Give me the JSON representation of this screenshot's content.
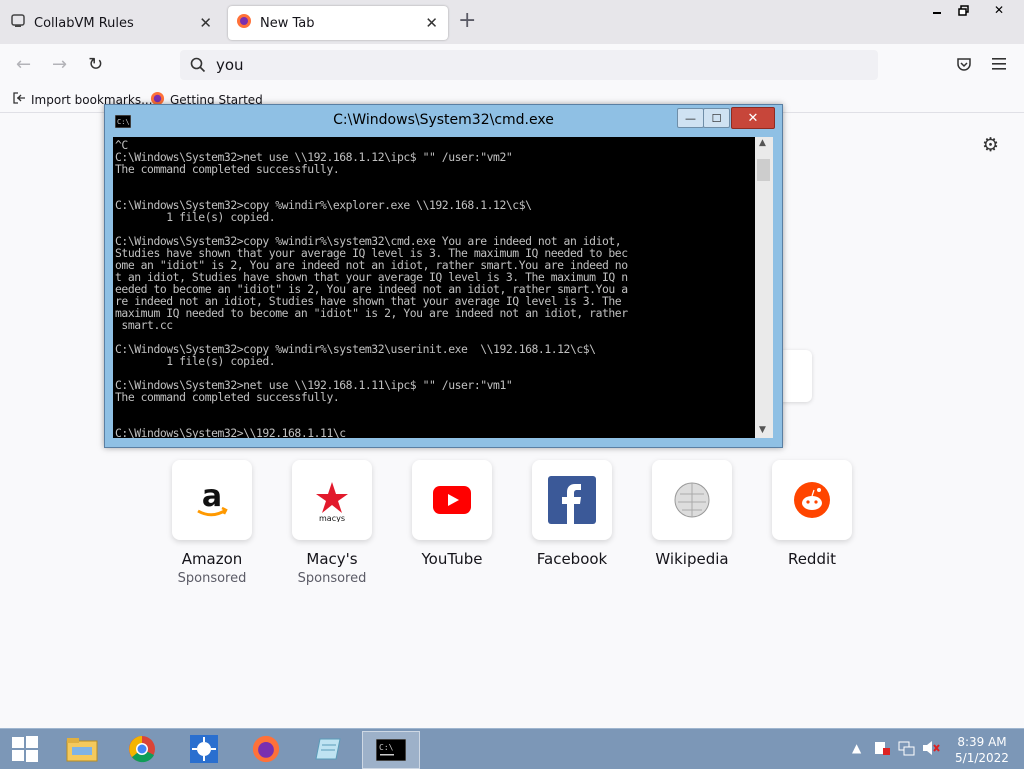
{
  "browser": {
    "tabs": [
      {
        "title": "CollabVM Rules",
        "active": false
      },
      {
        "title": "New Tab",
        "active": true
      }
    ],
    "url_text": "you",
    "bookmarks": [
      {
        "label": "Import bookmarks..."
      },
      {
        "label": "Getting Started"
      }
    ]
  },
  "cmd_window": {
    "title": "C:\\Windows\\System32\\cmd.exe",
    "console_text": "^C\nC:\\Windows\\System32>net use \\\\192.168.1.12\\ipc$ \"\" /user:\"vm2\"\nThe command completed successfully.\n\n\nC:\\Windows\\System32>copy %windir%\\explorer.exe \\\\192.168.1.12\\c$\\\n        1 file(s) copied.\n\nC:\\Windows\\System32>copy %windir%\\system32\\cmd.exe You are indeed not an idiot,\nStudies have shown that your average IQ level is 3. The maximum IQ needed to bec\nome an \"idiot\" is 2, You are indeed not an idiot, rather smart.You are indeed no\nt an idiot, Studies have shown that your average IQ level is 3. The maximum IQ n\needed to become an \"idiot\" is 2, You are indeed not an idiot, rather smart.You a\nre indeed not an idiot, Studies have shown that your average IQ level is 3. The\nmaximum IQ needed to become an \"idiot\" is 2, You are indeed not an idiot, rather\n smart.cc\n\nC:\\Windows\\System32>copy %windir%\\system32\\userinit.exe  \\\\192.168.1.12\\c$\\\n        1 file(s) copied.\n\nC:\\Windows\\System32>net use \\\\192.168.1.11\\ipc$ \"\" /user:\"vm1\"\nThe command completed successfully.\n\n\nC:\\Windows\\System32>\\\\192.168.1.11\\c"
  },
  "top_sites": [
    {
      "name": "Amazon",
      "sub": "Sponsored",
      "icon": "amazon-icon"
    },
    {
      "name": "Macy's",
      "sub": "Sponsored",
      "icon": "macys-icon"
    },
    {
      "name": "YouTube",
      "sub": "",
      "icon": "youtube-icon"
    },
    {
      "name": "Facebook",
      "sub": "",
      "icon": "facebook-icon"
    },
    {
      "name": "Wikipedia",
      "sub": "",
      "icon": "wikipedia-icon"
    },
    {
      "name": "Reddit",
      "sub": "",
      "icon": "reddit-icon"
    }
  ],
  "taskbar": {
    "items": [
      "start-icon",
      "file-explorer-icon",
      "chrome-icon",
      "app-icon",
      "firefox-icon",
      "notepad-icon",
      "cmd-icon"
    ],
    "time": "8:39 AM",
    "date": "5/1/2022"
  },
  "colors": {
    "taskbar": "#7c97b7",
    "cmd_frame": "#8fc0e4",
    "close_button": "#c7463a"
  }
}
